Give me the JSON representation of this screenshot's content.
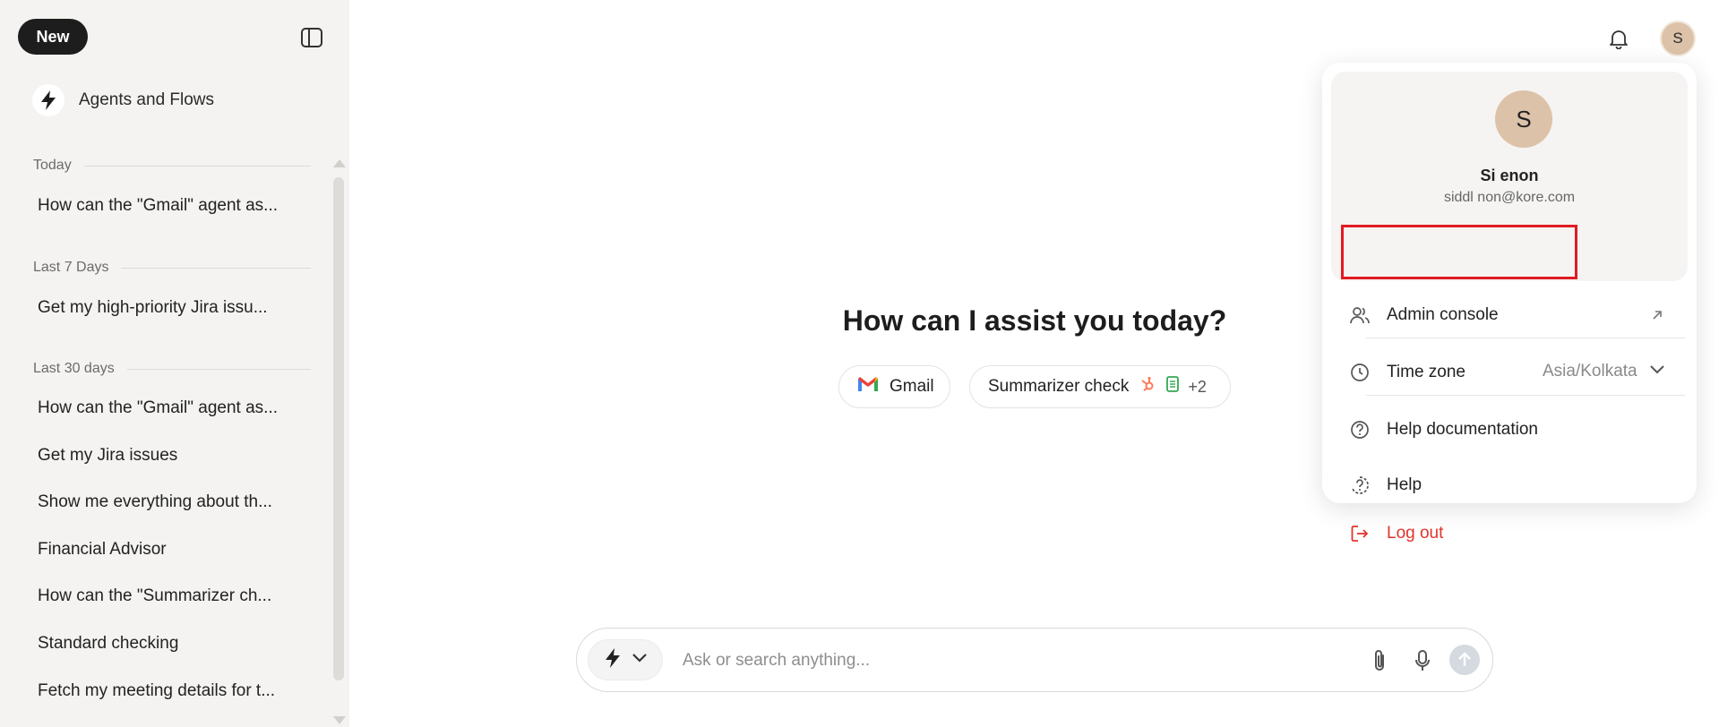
{
  "sidebar": {
    "new_label": "New",
    "agents_label": "Agents and Flows",
    "sections": [
      {
        "label": "Today",
        "items": [
          "How can the \"Gmail\" agent as..."
        ]
      },
      {
        "label": "Last 7 Days",
        "items": [
          "Get my high-priority Jira issu..."
        ]
      },
      {
        "label": "Last 30 days",
        "items": [
          "How can the \"Gmail\" agent as...",
          "Get my Jira issues",
          "Show me everything about th...",
          "Financial Advisor",
          "How can the \"Summarizer ch...",
          "Standard checking",
          "Fetch my meeting details for t..."
        ]
      }
    ]
  },
  "main": {
    "headline": "How can I assist you today?",
    "chips": [
      {
        "label": "Gmail",
        "icon": "gmail-icon"
      },
      {
        "label": "Summarizer check",
        "icon": "hubspot-icon",
        "extra": "+2"
      }
    ],
    "composer": {
      "placeholder": "Ask or search anything..."
    }
  },
  "header": {
    "avatar_initial": "S"
  },
  "profile_menu": {
    "avatar_initial": "S",
    "name": "Si            enon",
    "email": "siddl           non@kore.com",
    "items": {
      "admin": "Admin console",
      "timezone": "Time zone",
      "timezone_value": "Asia/Kolkata",
      "help_docs": "Help documentation",
      "help": "Help",
      "logout": "Log out"
    }
  },
  "colors": {
    "accent_red": "#e0342c",
    "highlight": "#e11b22",
    "avatar": "#dcc2a8"
  }
}
